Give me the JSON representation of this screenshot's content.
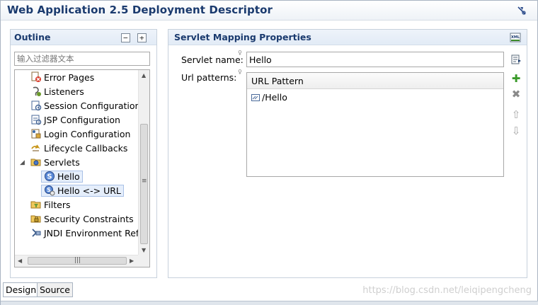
{
  "editor": {
    "title": "Web Application 2.5 Deployment Descriptor"
  },
  "outline": {
    "title": "Outline",
    "filter_placeholder": "输入过滤器文本",
    "items": [
      {
        "label": "Error Pages",
        "icon": "error-pages-icon"
      },
      {
        "label": "Listeners",
        "icon": "listeners-icon"
      },
      {
        "label": "Session Configuration",
        "icon": "session-config-icon"
      },
      {
        "label": "JSP Configuration",
        "icon": "jsp-config-icon"
      },
      {
        "label": "Login Configuration",
        "icon": "login-config-icon"
      },
      {
        "label": "Lifecycle Callbacks",
        "icon": "lifecycle-icon"
      },
      {
        "label": "Servlets",
        "icon": "servlets-folder-icon"
      },
      {
        "label": "Hello",
        "icon": "servlet-icon"
      },
      {
        "label": "Hello <-> URL",
        "icon": "servlet-mapping-icon"
      },
      {
        "label": "Filters",
        "icon": "filters-icon"
      },
      {
        "label": "Security Constraints",
        "icon": "security-icon"
      },
      {
        "label": "JNDI Environment Ref",
        "icon": "jndi-icon"
      }
    ]
  },
  "properties": {
    "title": "Servlet Mapping Properties",
    "servlet_name_label": "Servlet name:",
    "servlet_name_value": "Hello",
    "url_patterns_label": "Url patterns:",
    "table_header": "URL Pattern",
    "patterns": [
      "/Hello"
    ]
  },
  "tabs": [
    "Design",
    "Source"
  ],
  "watermark": "https://blog.csdn.net/leiqipengcheng",
  "colors": {
    "title": "#1a3a6e",
    "add": "#3a9a2a",
    "selection": "#e5eefb"
  }
}
